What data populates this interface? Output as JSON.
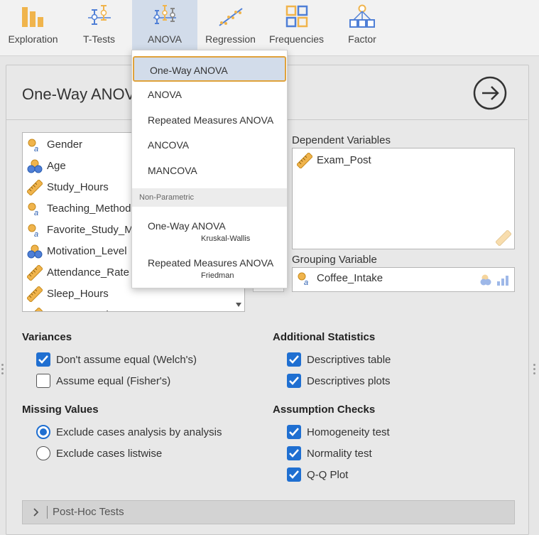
{
  "ribbon": {
    "tabs": [
      {
        "label": "Exploration",
        "icon": "exploration-icon"
      },
      {
        "label": "T-Tests",
        "icon": "ttests-icon"
      },
      {
        "label": "ANOVA",
        "icon": "anova-icon"
      },
      {
        "label": "Regression",
        "icon": "regression-icon"
      },
      {
        "label": "Frequencies",
        "icon": "frequencies-icon"
      },
      {
        "label": "Factor",
        "icon": "factor-icon"
      }
    ],
    "active_tab": "ANOVA"
  },
  "analysis": {
    "title": "One-Way ANOVA"
  },
  "variables": [
    {
      "name": "Gender",
      "type": "nominal-text"
    },
    {
      "name": "Age",
      "type": "nominal"
    },
    {
      "name": "Study_Hours",
      "type": "continuous"
    },
    {
      "name": "Teaching_Method",
      "type": "nominal-text"
    },
    {
      "name": "Favorite_Study_M",
      "type": "nominal-text"
    },
    {
      "name": "Motivation_Level",
      "type": "nominal"
    },
    {
      "name": "Attendance_Rate",
      "type": "continuous"
    },
    {
      "name": "Sleep_Hours",
      "type": "continuous"
    },
    {
      "name": "Stress_Level",
      "type": "continuous"
    }
  ],
  "dependent": {
    "label": "Dependent Variables",
    "items": [
      "Exam_Post"
    ]
  },
  "grouping": {
    "label": "Grouping Variable",
    "value": "Coffee_Intake"
  },
  "variances": {
    "heading": "Variances",
    "options": [
      {
        "label": "Don't assume equal (Welch's)",
        "checked": true
      },
      {
        "label": "Assume equal (Fisher's)",
        "checked": false
      }
    ]
  },
  "missing": {
    "heading": "Missing Values",
    "options": [
      {
        "label": "Exclude cases analysis by analysis",
        "selected": true
      },
      {
        "label": "Exclude cases listwise",
        "selected": false
      }
    ]
  },
  "additional": {
    "heading": "Additional Statistics",
    "options": [
      {
        "label": "Descriptives table",
        "checked": true
      },
      {
        "label": "Descriptives plots",
        "checked": true
      }
    ]
  },
  "assumptions": {
    "heading": "Assumption Checks",
    "options": [
      {
        "label": "Homogeneity test",
        "checked": true
      },
      {
        "label": "Normality test",
        "checked": true
      },
      {
        "label": "Q-Q Plot",
        "checked": true
      }
    ]
  },
  "posthoc": {
    "label": "Post-Hoc Tests"
  },
  "menu": {
    "items": [
      "One-Way ANOVA",
      "ANOVA",
      "Repeated Measures ANOVA",
      "ANCOVA",
      "MANCOVA"
    ],
    "nonparam_header": "Non-Parametric",
    "nonparam": [
      {
        "label": "One-Way ANOVA",
        "sub": "Kruskal-Wallis"
      },
      {
        "label": "Repeated Measures ANOVA",
        "sub": "Friedman"
      }
    ],
    "highlighted": "One-Way ANOVA"
  },
  "colors": {
    "accent": "#1f6fd1",
    "ribbon_active": "#d2dcea",
    "menu_focus_border": "#e0a23b",
    "icon_orange": "#f0b44c",
    "icon_blue": "#4f7fd6"
  }
}
